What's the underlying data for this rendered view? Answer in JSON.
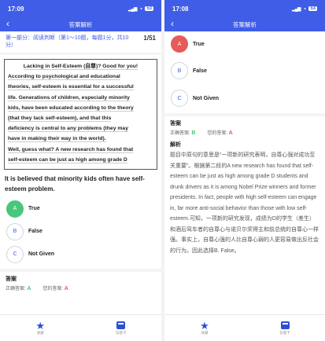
{
  "left": {
    "status": {
      "time": "17:09",
      "battery": "53"
    },
    "nav": {
      "back": "‹",
      "title": "答案解析"
    },
    "section": {
      "label": "第一部分：阅读判断（第1～10题，每题1分，共10分）",
      "count": "1/51"
    },
    "passage": [
      "Lacking in Self-Esteem (自尊)? Good for you!",
      "According to psychological and educational",
      "theories, self-esteem is essential for a successful",
      "life. Generations of children, especially minority",
      "kids, have been educated according to the theory",
      "(that they lack self-esteem), and that this",
      "deficiency is central to any problems (they may",
      "have in making their way in the world).",
      "Well, guess what? A new research has found that",
      "self-esteem can be just as high among grade D"
    ],
    "question": "It is believed that minority kids often have self-esteem problem.",
    "options": [
      {
        "letter": "A",
        "text": "True",
        "state": "correct"
      },
      {
        "letter": "B",
        "text": "False",
        "state": "normal"
      },
      {
        "letter": "C",
        "text": "Not Given",
        "state": "normal"
      }
    ],
    "answer": {
      "title": "答案",
      "correct_label": "正确答案:",
      "correct": "A",
      "yours_label": "您的答案:",
      "yours": "A"
    },
    "tabs": [
      {
        "icon": "star-icon",
        "label": "收藏"
      },
      {
        "icon": "calculator-icon",
        "label": "答题卡"
      }
    ]
  },
  "right": {
    "status": {
      "time": "17:08",
      "battery": "53"
    },
    "nav": {
      "back": "‹",
      "title": "答案解析"
    },
    "options": [
      {
        "letter": "A",
        "text": "True",
        "state": "wrong"
      },
      {
        "letter": "B",
        "text": "False",
        "state": "normal"
      },
      {
        "letter": "C",
        "text": "Not Given",
        "state": "normal"
      }
    ],
    "answer": {
      "title": "答案",
      "correct_label": "正确答案:",
      "correct": "B",
      "yours_label": "您的答案:",
      "yours": "A"
    },
    "analysis_title": "解析",
    "analysis": "题目中原句的意思是“一项新的研究表明，自尊心强对成功至关重要”。根据第二段的A new research has found that self-esteem can be just as high among grade D students and drunk drivers as it is among Nobel Prize winners and former presidents. In fact, people with high self-esteem can engage in, far more anti-social behavior than those with low self-esteem.可知，一项新的研究发现，成绩为D的学生（差生）和酒后驾车者的自尊心与诺贝尔奖得主和前总统的自尊心一样强。事实上，自尊心强的人比自尊心弱的人更容易做出反社会的行为。因此选择B. False。",
    "tabs": [
      {
        "icon": "star-icon",
        "label": "收藏"
      },
      {
        "icon": "calculator-icon",
        "label": "答题卡"
      }
    ]
  }
}
